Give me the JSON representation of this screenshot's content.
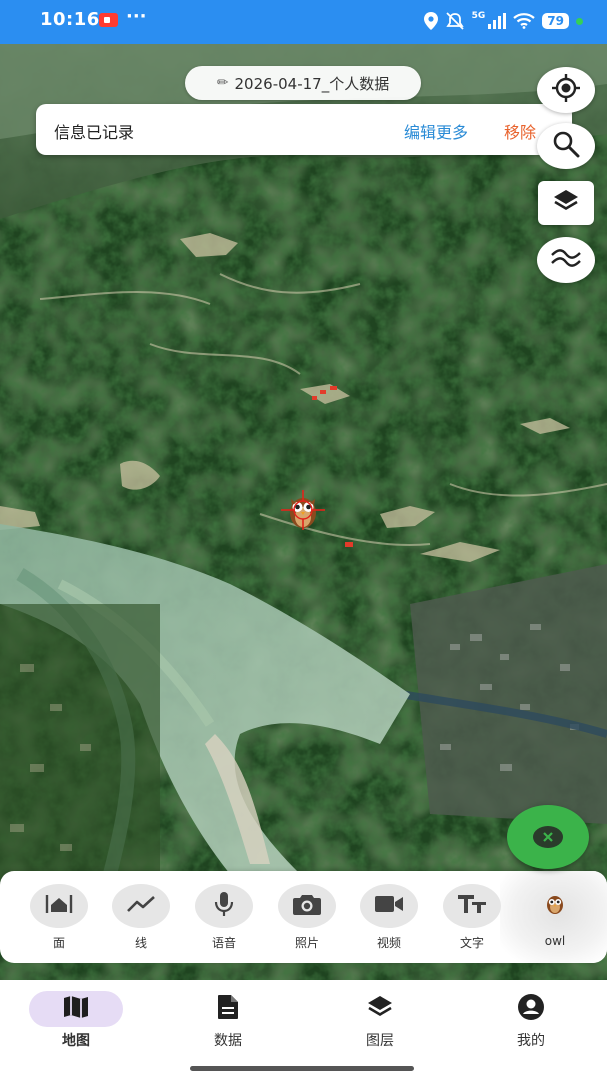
{
  "status_bar": {
    "time": "10:16",
    "battery": "79",
    "network": "5G",
    "icons": [
      "recording-icon",
      "more-dots-icon",
      "location-icon",
      "mute-icon",
      "signal-icon",
      "wifi-icon",
      "battery-icon"
    ]
  },
  "record": {
    "title": "2026-04-17_个人数据",
    "info_text": "信息已记录",
    "edit_more": "编辑更多",
    "remove": "移除"
  },
  "map_controls": [
    "locate-icon",
    "search-icon",
    "layers-icon",
    "wave-icon"
  ],
  "toolbar": {
    "tools": [
      {
        "label": "面",
        "icon": "polygon-icon"
      },
      {
        "label": "线",
        "icon": "line-icon"
      },
      {
        "label": "语音",
        "icon": "microphone-icon"
      },
      {
        "label": "照片",
        "icon": "camera-icon"
      },
      {
        "label": "视频",
        "icon": "video-icon"
      },
      {
        "label": "文字",
        "icon": "text-icon"
      },
      {
        "label": "owl",
        "icon": "owl-icon"
      }
    ]
  },
  "bottom_nav": {
    "items": [
      {
        "label": "地图",
        "icon": "map-icon",
        "active": true
      },
      {
        "label": "数据",
        "icon": "document-icon",
        "active": false
      },
      {
        "label": "图层",
        "icon": "layers-icon",
        "active": false
      },
      {
        "label": "我的",
        "icon": "profile-icon",
        "active": false
      }
    ]
  },
  "colors": {
    "status_bar": "#2b8ef1",
    "link_blue": "#2a8bd6",
    "remove_orange": "#e8622c",
    "close_fab": "#3bb34a",
    "nav_active_bg": "#e6dcf5"
  }
}
